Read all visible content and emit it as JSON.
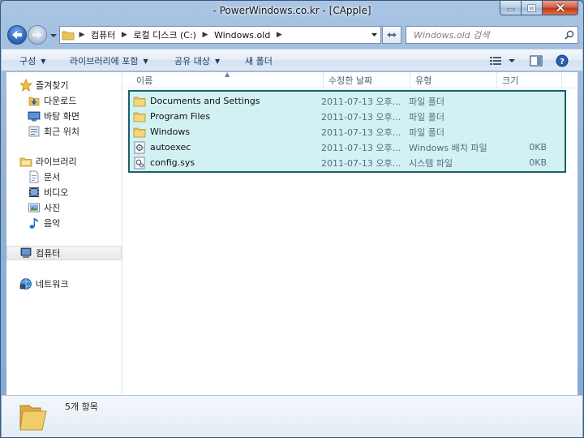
{
  "window": {
    "title": "- PowerWindows.co.kr - [CApple]"
  },
  "address": {
    "crumbs": [
      "컴퓨터",
      "로컬 디스크 (C:)",
      "Windows.old"
    ],
    "search_placeholder": "Windows.old 검색"
  },
  "toolbar": {
    "organize": "구성",
    "include_library": "라이브러리에 포함",
    "share_with": "공유 대상",
    "new_folder": "새 폴더"
  },
  "nav": {
    "favorites": "즐겨찾기",
    "downloads": "다운로드",
    "desktop": "바탕 화면",
    "recent": "최근 위치",
    "libraries": "라이브러리",
    "documents": "문서",
    "videos": "비디오",
    "pictures": "사진",
    "music": "음악",
    "computer": "컴퓨터",
    "network": "네트워크"
  },
  "columns": {
    "name": "이름",
    "date": "수정한 날짜",
    "type": "유형",
    "size": "크기"
  },
  "files": [
    {
      "name": "Documents and Settings",
      "date": "2011-07-13 오후...",
      "type": "파일 폴더",
      "size": "",
      "icon": "folder-icon"
    },
    {
      "name": "Program Files",
      "date": "2011-07-13 오후...",
      "type": "파일 폴더",
      "size": "",
      "icon": "folder-icon"
    },
    {
      "name": "Windows",
      "date": "2011-07-13 오후...",
      "type": "파일 폴더",
      "size": "",
      "icon": "folder-icon"
    },
    {
      "name": "autoexec",
      "date": "2011-07-13 오후...",
      "type": "Windows 배치 파일",
      "size": "0KB",
      "icon": "batch-file-icon"
    },
    {
      "name": "config.sys",
      "date": "2011-07-13 오후...",
      "type": "시스템 파일",
      "size": "0KB",
      "icon": "system-file-icon"
    }
  ],
  "status": {
    "item_count": "5개 항목"
  },
  "colors": {
    "selection_fill": "#d2f1f3",
    "selection_border": "#1c5f67",
    "folder": "#e8c25a"
  }
}
